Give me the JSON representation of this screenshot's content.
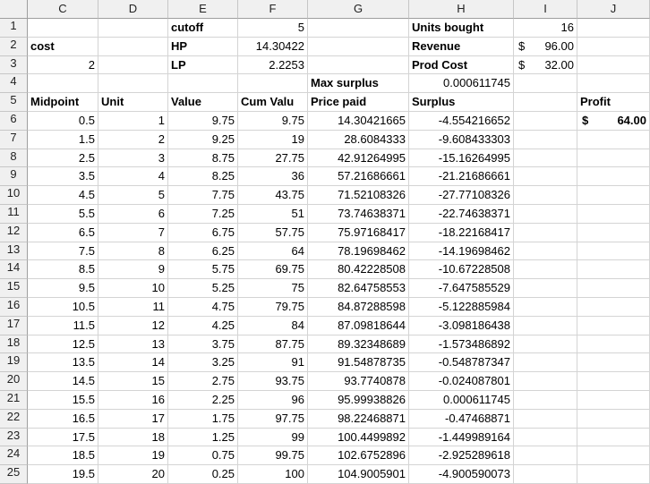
{
  "columns": [
    "C",
    "D",
    "E",
    "F",
    "G",
    "H",
    "I",
    "J"
  ],
  "rows": [
    [
      {
        "v": ""
      },
      {
        "v": ""
      },
      {
        "v": "cutoff",
        "b": true
      },
      {
        "v": "5",
        "a": "r"
      },
      {
        "v": ""
      },
      {
        "v": "Units bought",
        "b": true
      },
      {
        "v": "16",
        "a": "r"
      },
      {
        "v": ""
      }
    ],
    [
      {
        "v": "cost",
        "b": true
      },
      {
        "v": ""
      },
      {
        "v": "HP",
        "b": true
      },
      {
        "v": "14.30422",
        "a": "r"
      },
      {
        "v": ""
      },
      {
        "v": "Revenue",
        "b": true
      },
      {
        "cur": true,
        "sym": "$",
        "v": "96.00"
      },
      {
        "v": ""
      }
    ],
    [
      {
        "v": "2",
        "a": "r"
      },
      {
        "v": ""
      },
      {
        "v": "LP",
        "b": true
      },
      {
        "v": "2.2253",
        "a": "r"
      },
      {
        "v": ""
      },
      {
        "v": "Prod Cost",
        "b": true
      },
      {
        "cur": true,
        "sym": "$",
        "v": "32.00"
      },
      {
        "v": ""
      }
    ],
    [
      {
        "v": ""
      },
      {
        "v": ""
      },
      {
        "v": ""
      },
      {
        "v": ""
      },
      {
        "v": "Max surplus",
        "b": true
      },
      {
        "v": "0.000611745",
        "a": "r"
      },
      {
        "v": ""
      },
      {
        "v": ""
      }
    ],
    [
      {
        "v": "Midpoint",
        "b": true
      },
      {
        "v": "Unit",
        "b": true
      },
      {
        "v": "Value",
        "b": true
      },
      {
        "v": "Cum Valu",
        "b": true
      },
      {
        "v": "Price paid",
        "b": true
      },
      {
        "v": "Surplus",
        "b": true
      },
      {
        "v": ""
      },
      {
        "v": "Profit",
        "b": true
      }
    ],
    [
      {
        "v": "0.5",
        "a": "r"
      },
      {
        "v": "1",
        "a": "r"
      },
      {
        "v": "9.75",
        "a": "r"
      },
      {
        "v": "9.75",
        "a": "r"
      },
      {
        "v": "14.30421665",
        "a": "r"
      },
      {
        "v": "-4.554216652",
        "a": "r"
      },
      {
        "v": ""
      },
      {
        "cur": true,
        "sym": "$",
        "v": "64.00",
        "b": true
      }
    ],
    [
      {
        "v": "1.5",
        "a": "r"
      },
      {
        "v": "2",
        "a": "r"
      },
      {
        "v": "9.25",
        "a": "r"
      },
      {
        "v": "19",
        "a": "r"
      },
      {
        "v": "28.6084333",
        "a": "r"
      },
      {
        "v": "-9.608433303",
        "a": "r"
      },
      {
        "v": ""
      },
      {
        "v": ""
      }
    ],
    [
      {
        "v": "2.5",
        "a": "r"
      },
      {
        "v": "3",
        "a": "r"
      },
      {
        "v": "8.75",
        "a": "r"
      },
      {
        "v": "27.75",
        "a": "r"
      },
      {
        "v": "42.91264995",
        "a": "r"
      },
      {
        "v": "-15.16264995",
        "a": "r"
      },
      {
        "v": ""
      },
      {
        "v": ""
      }
    ],
    [
      {
        "v": "3.5",
        "a": "r"
      },
      {
        "v": "4",
        "a": "r"
      },
      {
        "v": "8.25",
        "a": "r"
      },
      {
        "v": "36",
        "a": "r"
      },
      {
        "v": "57.21686661",
        "a": "r"
      },
      {
        "v": "-21.21686661",
        "a": "r"
      },
      {
        "v": ""
      },
      {
        "v": ""
      }
    ],
    [
      {
        "v": "4.5",
        "a": "r"
      },
      {
        "v": "5",
        "a": "r"
      },
      {
        "v": "7.75",
        "a": "r"
      },
      {
        "v": "43.75",
        "a": "r"
      },
      {
        "v": "71.52108326",
        "a": "r"
      },
      {
        "v": "-27.77108326",
        "a": "r"
      },
      {
        "v": ""
      },
      {
        "v": ""
      }
    ],
    [
      {
        "v": "5.5",
        "a": "r"
      },
      {
        "v": "6",
        "a": "r"
      },
      {
        "v": "7.25",
        "a": "r"
      },
      {
        "v": "51",
        "a": "r"
      },
      {
        "v": "73.74638371",
        "a": "r"
      },
      {
        "v": "-22.74638371",
        "a": "r"
      },
      {
        "v": ""
      },
      {
        "v": ""
      }
    ],
    [
      {
        "v": "6.5",
        "a": "r"
      },
      {
        "v": "7",
        "a": "r"
      },
      {
        "v": "6.75",
        "a": "r"
      },
      {
        "v": "57.75",
        "a": "r"
      },
      {
        "v": "75.97168417",
        "a": "r"
      },
      {
        "v": "-18.22168417",
        "a": "r"
      },
      {
        "v": ""
      },
      {
        "v": ""
      }
    ],
    [
      {
        "v": "7.5",
        "a": "r"
      },
      {
        "v": "8",
        "a": "r"
      },
      {
        "v": "6.25",
        "a": "r"
      },
      {
        "v": "64",
        "a": "r"
      },
      {
        "v": "78.19698462",
        "a": "r"
      },
      {
        "v": "-14.19698462",
        "a": "r"
      },
      {
        "v": ""
      },
      {
        "v": ""
      }
    ],
    [
      {
        "v": "8.5",
        "a": "r"
      },
      {
        "v": "9",
        "a": "r"
      },
      {
        "v": "5.75",
        "a": "r"
      },
      {
        "v": "69.75",
        "a": "r"
      },
      {
        "v": "80.42228508",
        "a": "r"
      },
      {
        "v": "-10.67228508",
        "a": "r"
      },
      {
        "v": ""
      },
      {
        "v": ""
      }
    ],
    [
      {
        "v": "9.5",
        "a": "r"
      },
      {
        "v": "10",
        "a": "r"
      },
      {
        "v": "5.25",
        "a": "r"
      },
      {
        "v": "75",
        "a": "r"
      },
      {
        "v": "82.64758553",
        "a": "r"
      },
      {
        "v": "-7.647585529",
        "a": "r"
      },
      {
        "v": ""
      },
      {
        "v": ""
      }
    ],
    [
      {
        "v": "10.5",
        "a": "r"
      },
      {
        "v": "11",
        "a": "r"
      },
      {
        "v": "4.75",
        "a": "r"
      },
      {
        "v": "79.75",
        "a": "r"
      },
      {
        "v": "84.87288598",
        "a": "r"
      },
      {
        "v": "-5.122885984",
        "a": "r"
      },
      {
        "v": ""
      },
      {
        "v": ""
      }
    ],
    [
      {
        "v": "11.5",
        "a": "r"
      },
      {
        "v": "12",
        "a": "r"
      },
      {
        "v": "4.25",
        "a": "r"
      },
      {
        "v": "84",
        "a": "r"
      },
      {
        "v": "87.09818644",
        "a": "r"
      },
      {
        "v": "-3.098186438",
        "a": "r"
      },
      {
        "v": ""
      },
      {
        "v": ""
      }
    ],
    [
      {
        "v": "12.5",
        "a": "r"
      },
      {
        "v": "13",
        "a": "r"
      },
      {
        "v": "3.75",
        "a": "r"
      },
      {
        "v": "87.75",
        "a": "r"
      },
      {
        "v": "89.32348689",
        "a": "r"
      },
      {
        "v": "-1.573486892",
        "a": "r"
      },
      {
        "v": ""
      },
      {
        "v": ""
      }
    ],
    [
      {
        "v": "13.5",
        "a": "r"
      },
      {
        "v": "14",
        "a": "r"
      },
      {
        "v": "3.25",
        "a": "r"
      },
      {
        "v": "91",
        "a": "r"
      },
      {
        "v": "91.54878735",
        "a": "r"
      },
      {
        "v": "-0.548787347",
        "a": "r"
      },
      {
        "v": ""
      },
      {
        "v": ""
      }
    ],
    [
      {
        "v": "14.5",
        "a": "r"
      },
      {
        "v": "15",
        "a": "r"
      },
      {
        "v": "2.75",
        "a": "r"
      },
      {
        "v": "93.75",
        "a": "r"
      },
      {
        "v": "93.7740878",
        "a": "r"
      },
      {
        "v": "-0.024087801",
        "a": "r"
      },
      {
        "v": ""
      },
      {
        "v": ""
      }
    ],
    [
      {
        "v": "15.5",
        "a": "r"
      },
      {
        "v": "16",
        "a": "r"
      },
      {
        "v": "2.25",
        "a": "r"
      },
      {
        "v": "96",
        "a": "r"
      },
      {
        "v": "95.99938826",
        "a": "r"
      },
      {
        "v": "0.000611745",
        "a": "r"
      },
      {
        "v": ""
      },
      {
        "v": ""
      }
    ],
    [
      {
        "v": "16.5",
        "a": "r"
      },
      {
        "v": "17",
        "a": "r"
      },
      {
        "v": "1.75",
        "a": "r"
      },
      {
        "v": "97.75",
        "a": "r"
      },
      {
        "v": "98.22468871",
        "a": "r"
      },
      {
        "v": "-0.47468871",
        "a": "r"
      },
      {
        "v": ""
      },
      {
        "v": ""
      }
    ],
    [
      {
        "v": "17.5",
        "a": "r"
      },
      {
        "v": "18",
        "a": "r"
      },
      {
        "v": "1.25",
        "a": "r"
      },
      {
        "v": "99",
        "a": "r"
      },
      {
        "v": "100.4499892",
        "a": "r"
      },
      {
        "v": "-1.449989164",
        "a": "r"
      },
      {
        "v": ""
      },
      {
        "v": ""
      }
    ],
    [
      {
        "v": "18.5",
        "a": "r"
      },
      {
        "v": "19",
        "a": "r"
      },
      {
        "v": "0.75",
        "a": "r"
      },
      {
        "v": "99.75",
        "a": "r"
      },
      {
        "v": "102.6752896",
        "a": "r"
      },
      {
        "v": "-2.925289618",
        "a": "r"
      },
      {
        "v": ""
      },
      {
        "v": ""
      }
    ],
    [
      {
        "v": "19.5",
        "a": "r"
      },
      {
        "v": "20",
        "a": "r"
      },
      {
        "v": "0.25",
        "a": "r"
      },
      {
        "v": "100",
        "a": "r"
      },
      {
        "v": "104.9005901",
        "a": "r"
      },
      {
        "v": "-4.900590073",
        "a": "r"
      },
      {
        "v": ""
      },
      {
        "v": ""
      }
    ]
  ]
}
